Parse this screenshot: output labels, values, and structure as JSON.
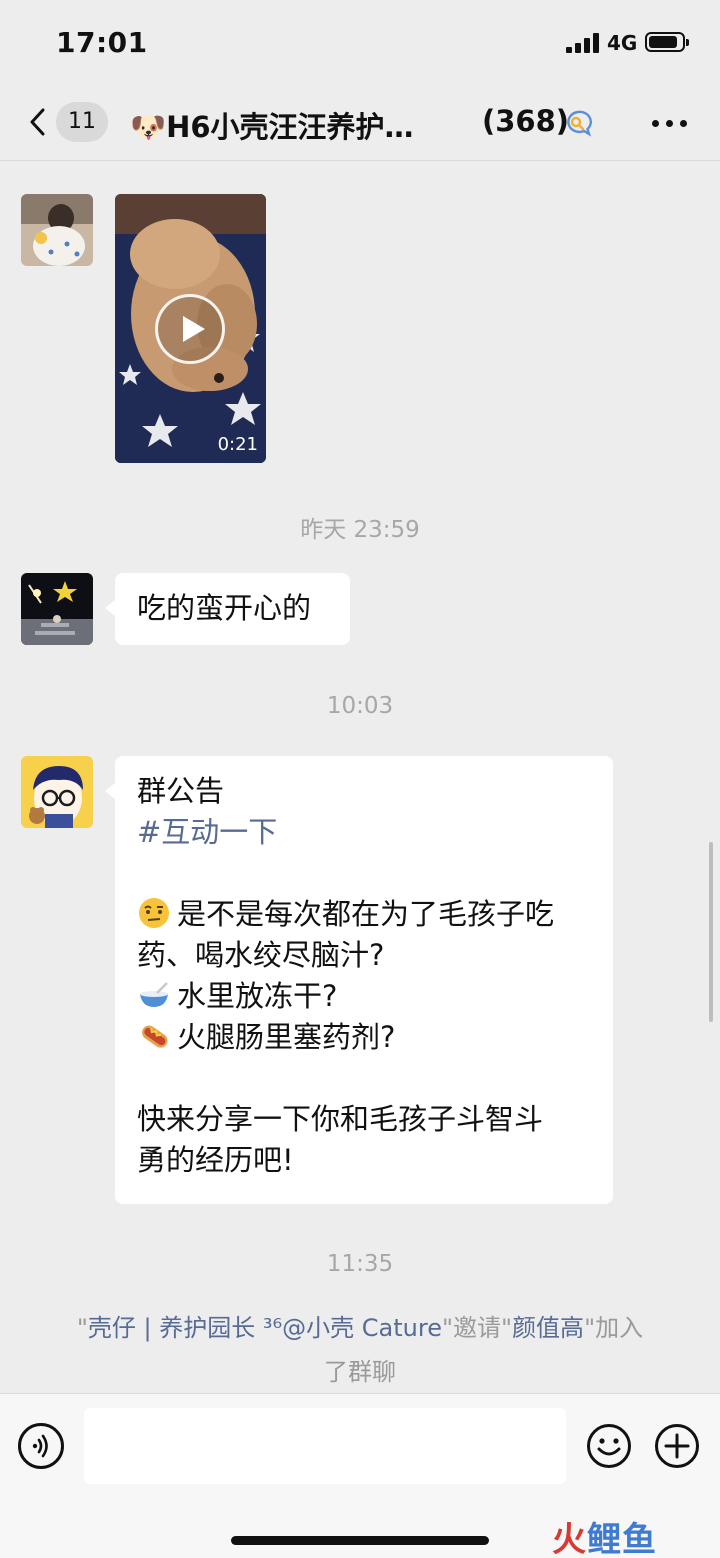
{
  "status_bar": {
    "time": "17:01",
    "network": "4G"
  },
  "nav": {
    "unread_count": "11",
    "title": "🐶H6小壳汪汪养护…",
    "member_count": "(368)"
  },
  "messages": {
    "video": {
      "duration": "0:21"
    },
    "timestamp_1": "昨天 23:59",
    "text_message": "吃的蛮开心的",
    "timestamp_2": "10:03",
    "announcement": {
      "heading": "群公告",
      "tag": "#互动一下",
      "line_1": "是不是每次都在为了毛孩子吃",
      "line_2": "药、喝水绞尽脑汁?",
      "line_3": "水里放冻干?",
      "line_4": "火腿肠里塞药剂?",
      "line_5": "快来分享一下你和毛孩子斗智斗",
      "line_6": "勇的经历吧!"
    },
    "timestamp_3": "11:35",
    "system": {
      "inviter": "壳仔 | 养护园长 ³⁶@小壳 Cature",
      "verb": "邀请",
      "invitee": "颜值高",
      "suffix": "加入",
      "suffix_2": "了群聊"
    }
  },
  "input": {
    "placeholder": ""
  },
  "watermark": {
    "part_1": "火",
    "part_2": "鲤鱼"
  },
  "colors": {
    "background": "#ededed",
    "link": "#576b95",
    "timestamp": "#a7a7a7"
  },
  "icons": [
    "back-chevron-icon",
    "search-chat-icon",
    "more-dots-icon",
    "play-icon",
    "voice-icon",
    "emoji-icon",
    "plus-icon",
    "raised-eyebrow-emoji",
    "bowl-emoji",
    "hotdog-emoji"
  ]
}
